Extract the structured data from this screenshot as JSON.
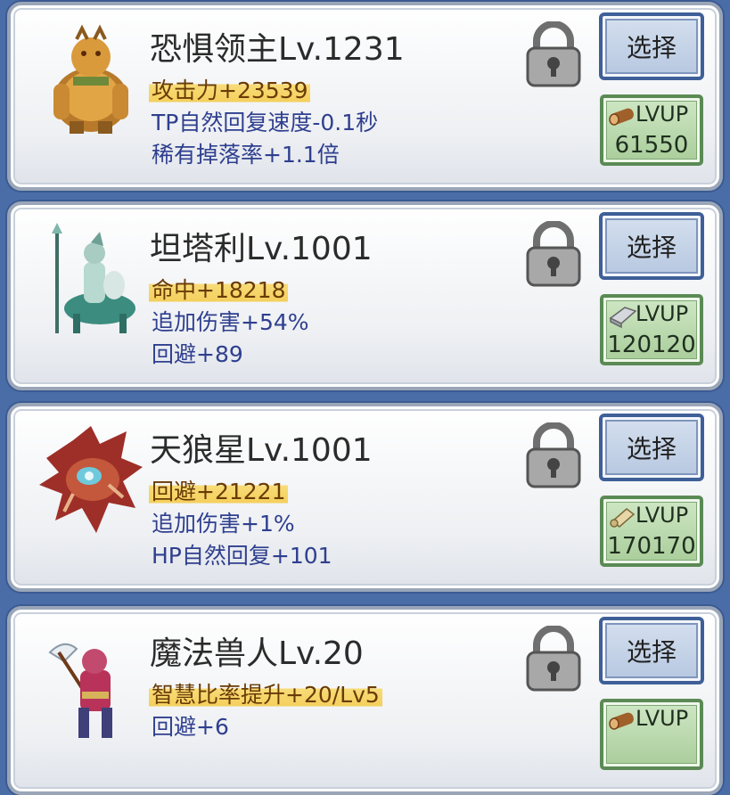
{
  "colors": {
    "background": "#4a6da8",
    "highlight_stat": "#f4cf5c",
    "blue_stat_text": "#2f3f8f",
    "select_button": "#b6c7e0",
    "lvup_button": "#a9cd9a"
  },
  "cards": [
    {
      "name": "恐惧领主Lv.1231",
      "portrait": "fear-lord-portrait",
      "stats": [
        "攻击力+23539",
        "TP自然回复速度-0.1秒",
        "稀有掉落率+1.1倍"
      ],
      "select_label": "选择",
      "lvup_label": "LVUP",
      "lvup_icon": "log-icon",
      "lvup_cost": "61550"
    },
    {
      "name": "坦塔利Lv.1001",
      "portrait": "tantali-portrait",
      "stats": [
        "命中+18218",
        "追加伤害+54%",
        "回避+89"
      ],
      "select_label": "选择",
      "lvup_label": "LVUP",
      "lvup_icon": "iron-ingot-icon",
      "lvup_cost": "120120"
    },
    {
      "name": "天狼星Lv.1001",
      "portrait": "sirius-portrait",
      "stats": [
        "回避+21221",
        "追加伤害+1%",
        "HP自然回复+101"
      ],
      "select_label": "选择",
      "lvup_label": "LVUP",
      "lvup_icon": "scroll-icon",
      "lvup_cost": "170170"
    },
    {
      "name": "魔法兽人Lv.20",
      "portrait": "magic-orc-portrait",
      "stats": [
        "智慧比率提升+20/Lv5",
        "回避+6"
      ],
      "select_label": "选择",
      "lvup_label": "LVUP",
      "lvup_icon": "log-icon"
    }
  ]
}
